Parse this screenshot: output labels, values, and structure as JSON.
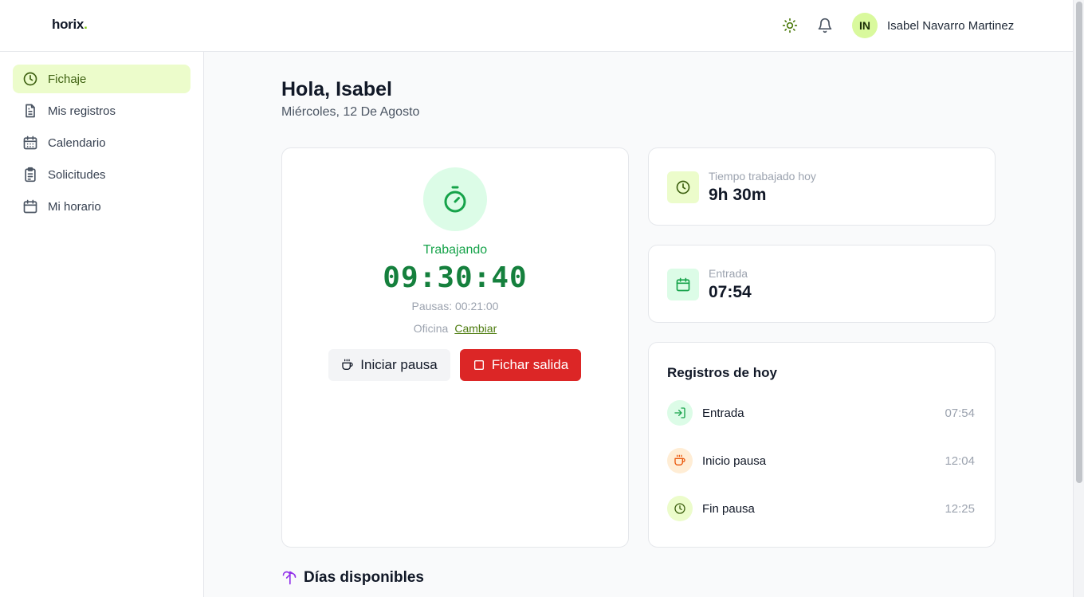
{
  "app": {
    "logo_text": "horix",
    "logo_dot": "."
  },
  "header": {
    "theme_icon": "sun-icon",
    "notifications_icon": "bell-icon",
    "user": {
      "initials": "IN",
      "name": "Isabel Navarro Martinez"
    }
  },
  "sidebar": {
    "items": [
      {
        "label": "Fichaje",
        "icon": "clock-icon",
        "active": true
      },
      {
        "label": "Mis registros",
        "icon": "document-icon",
        "active": false
      },
      {
        "label": "Calendario",
        "icon": "calendar-grid-icon",
        "active": false
      },
      {
        "label": "Solicitudes",
        "icon": "clipboard-icon",
        "active": false
      },
      {
        "label": "Mi horario",
        "icon": "calendar-icon",
        "active": false
      }
    ]
  },
  "main": {
    "greeting": "Hola, Isabel",
    "date": "Miércoles, 12 De Agosto",
    "clock_card": {
      "icon": "timer-icon",
      "status": "Trabajando",
      "elapsed": "09:30:40",
      "pauses": "Pausas: 00:21:00",
      "location": "Oficina",
      "change_label": "Cambiar",
      "pause_button": "Iniciar pausa",
      "clockout_button": "Fichar salida"
    },
    "stats": [
      {
        "label": "Tiempo trabajado hoy",
        "value": "9h 30m",
        "icon": "clock-icon"
      },
      {
        "label": "Entrada",
        "value": "07:54",
        "icon": "calendar-icon"
      }
    ],
    "today_records": {
      "title": "Registros de hoy",
      "items": [
        {
          "label": "Entrada",
          "time": "07:54",
          "icon": "login-icon"
        },
        {
          "label": "Inicio pausa",
          "time": "12:04",
          "icon": "coffee-icon"
        },
        {
          "label": "Fin pausa",
          "time": "12:25",
          "icon": "clock-icon"
        }
      ]
    },
    "available_days": {
      "title": "Días disponibles",
      "icon": "palm-tree-icon"
    }
  },
  "colors": {
    "accent": "#84cc16",
    "active_bg": "#ecfccb",
    "working_green": "#16a34a",
    "danger": "#dc2626",
    "pause_orange": "#ea580c"
  }
}
